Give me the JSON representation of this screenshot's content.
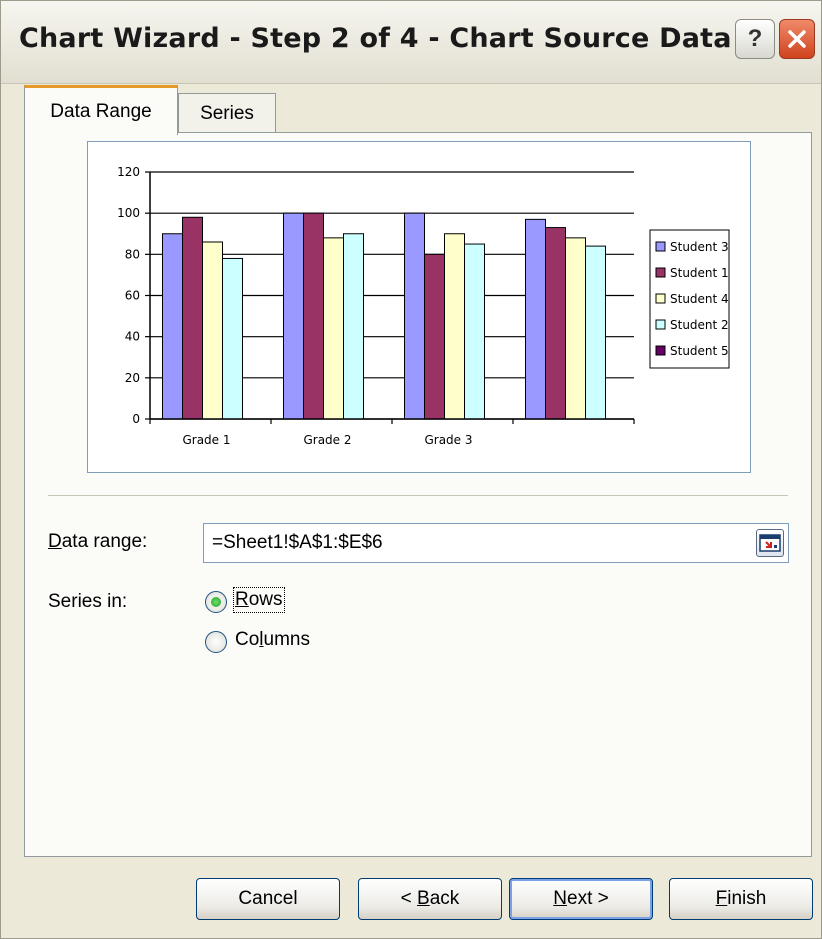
{
  "window": {
    "title": "Chart Wizard - Step 2 of 4 - Chart Source Data",
    "help_label": "?",
    "close_icon": "close-icon"
  },
  "tabs": [
    {
      "label": "Data Range",
      "active": true
    },
    {
      "label": "Series",
      "active": false
    }
  ],
  "chart_data": {
    "type": "bar",
    "categories": [
      "Grade 1",
      "Grade 2",
      "Grade 3",
      ""
    ],
    "series": [
      {
        "name": "Student 3",
        "color": "#9999ff",
        "values": [
          90,
          100,
          100,
          97
        ]
      },
      {
        "name": "Student 1",
        "color": "#993366",
        "values": [
          98,
          100,
          80,
          93
        ]
      },
      {
        "name": "Student 4",
        "color": "#ffffcc",
        "values": [
          86,
          88,
          90,
          88
        ]
      },
      {
        "name": "Student 2",
        "color": "#ccffff",
        "values": [
          78,
          90,
          85,
          84
        ]
      },
      {
        "name": "Student 5",
        "color": "#660066",
        "values": []
      }
    ],
    "ylim": [
      0,
      120
    ],
    "yticks": [
      0,
      20,
      40,
      60,
      80,
      100,
      120
    ],
    "grid": true,
    "legend": "right"
  },
  "data_range": {
    "label_prefix": "",
    "label_mnemonic": "D",
    "label_rest": "ata range:",
    "value": "=Sheet1!$A$1:$E$6",
    "button_icon": "collapse-dialog-icon"
  },
  "series_in": {
    "label": "Series in:",
    "options": [
      {
        "mnemonic": "R",
        "rest": "ows",
        "selected": true
      },
      {
        "pre": "Co",
        "mnemonic": "l",
        "rest": "umns",
        "selected": false
      }
    ]
  },
  "buttons": {
    "cancel": "Cancel",
    "back_pre": "< ",
    "back_mn": "B",
    "back_rest": "ack",
    "next_mn": "N",
    "next_rest": "ext >",
    "finish_mn": "F",
    "finish_rest": "inish"
  }
}
